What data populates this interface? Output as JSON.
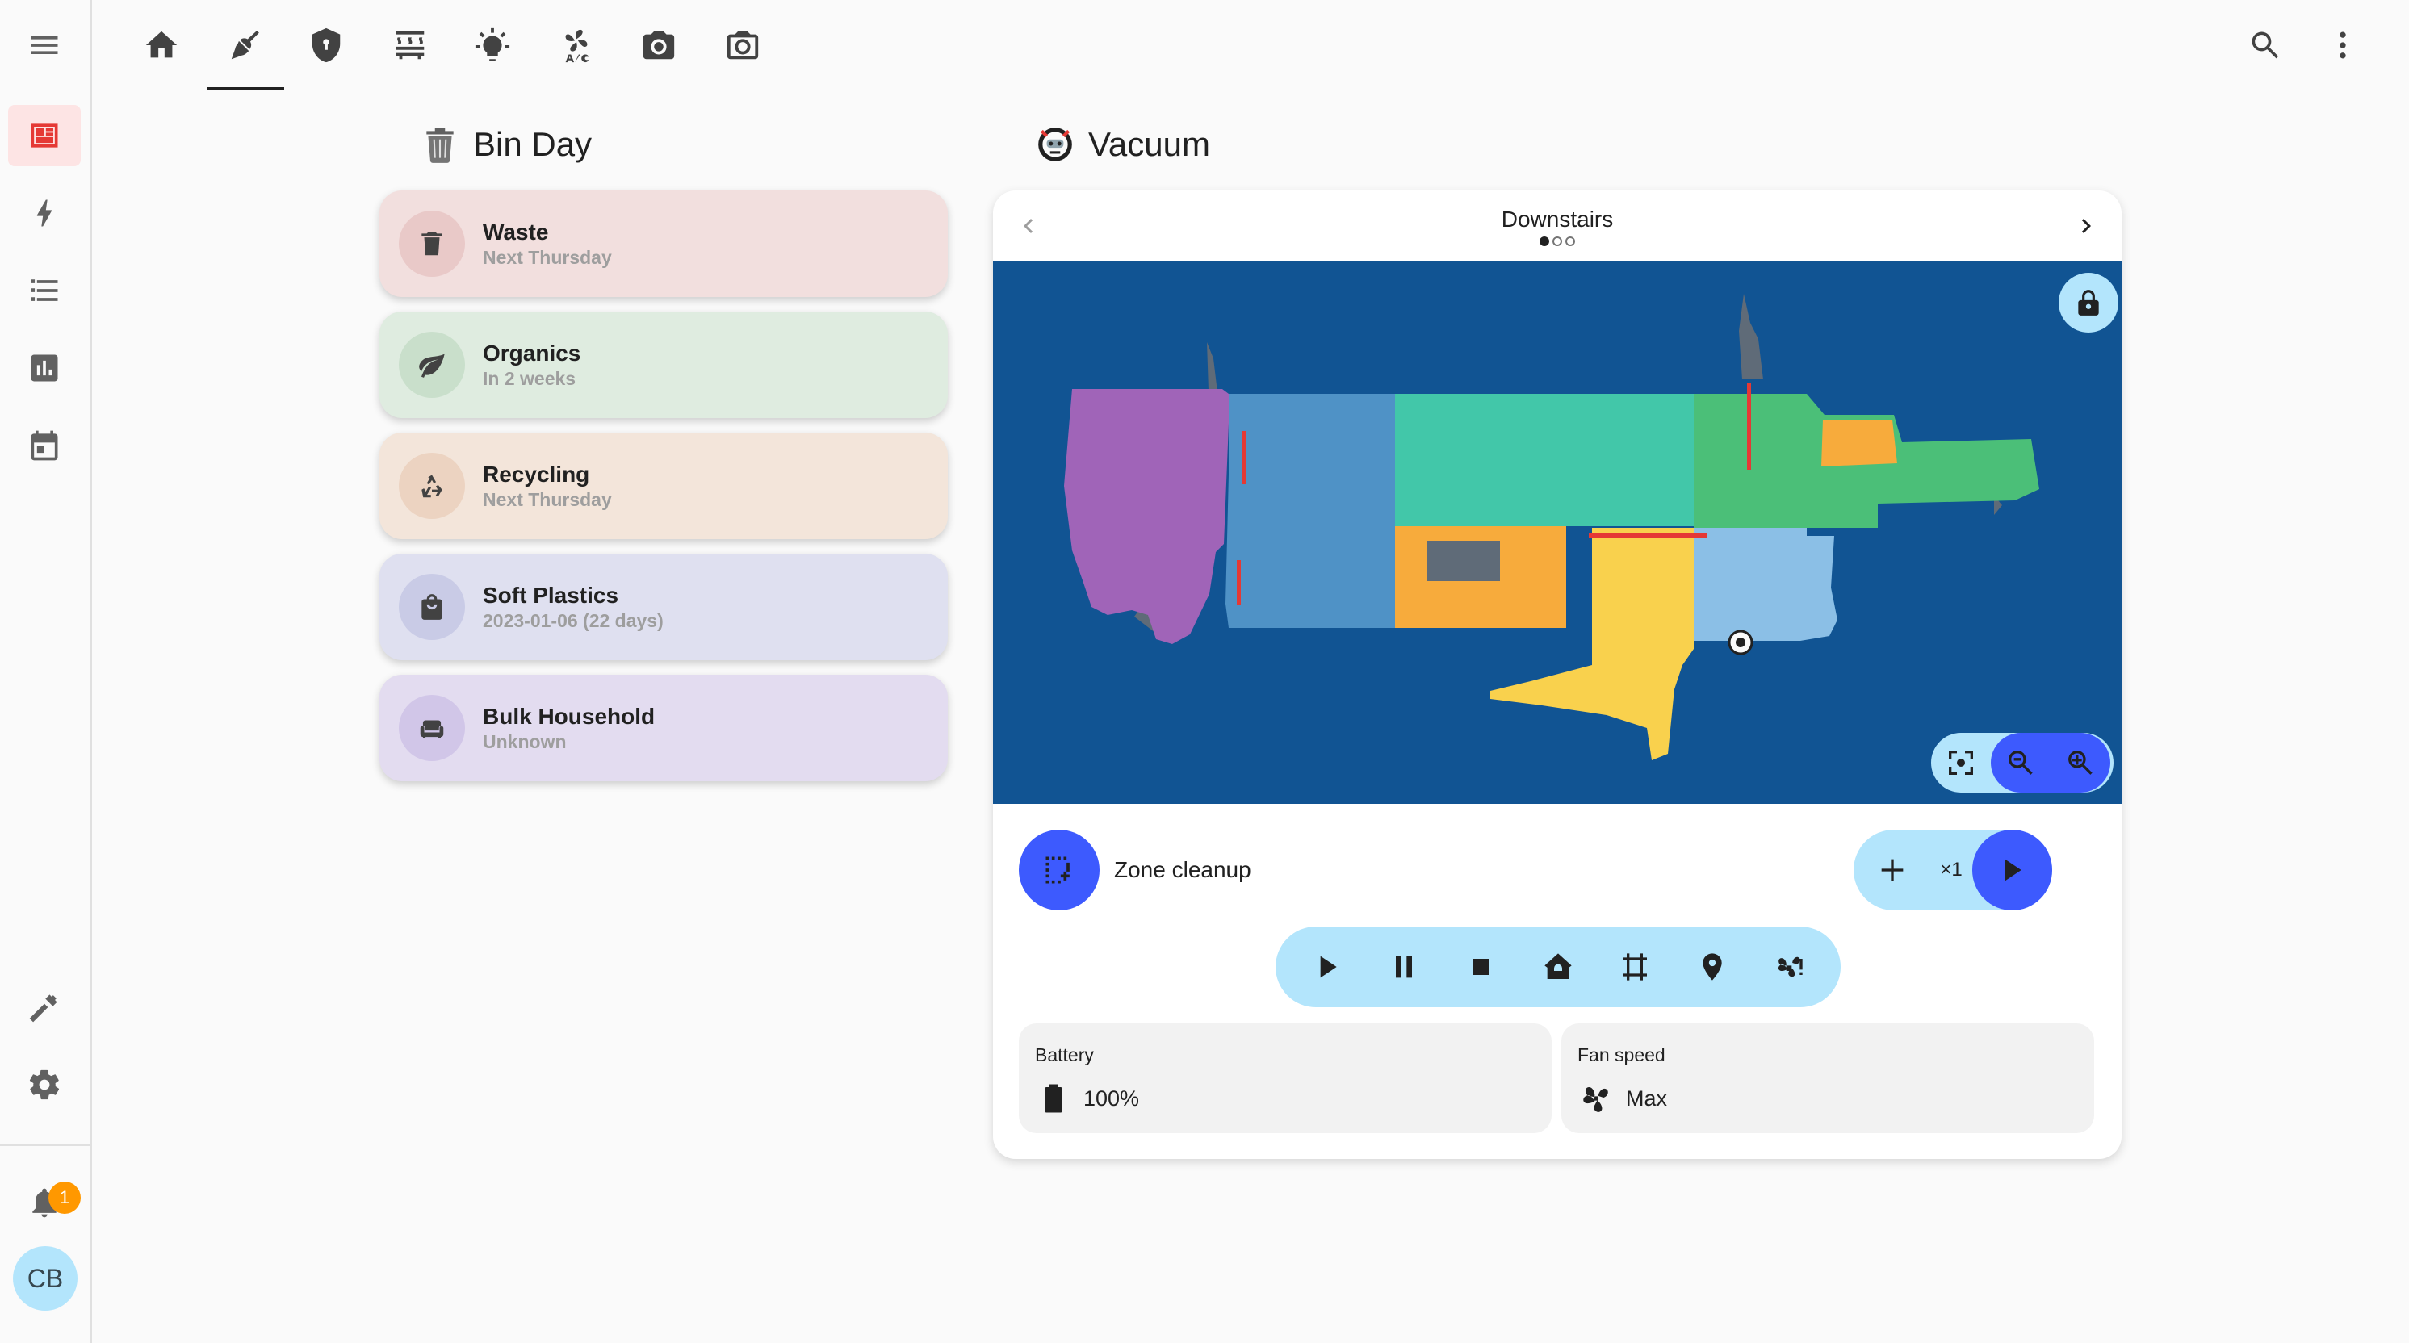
{
  "sidebar": {
    "items": [
      {
        "name": "overview",
        "icon": "dashboard-icon",
        "active": true
      },
      {
        "name": "energy",
        "icon": "lightning-icon"
      },
      {
        "name": "logbook",
        "icon": "list-icon"
      },
      {
        "name": "history",
        "icon": "chart-icon"
      },
      {
        "name": "calendar",
        "icon": "calendar-icon"
      }
    ],
    "developer_tools_icon": "hammer-icon",
    "settings_icon": "gear-icon",
    "notifications": {
      "icon": "bell-icon",
      "count": "1"
    },
    "user_initials": "CB"
  },
  "topbar": {
    "tabs": [
      {
        "icon": "home-icon"
      },
      {
        "icon": "broom-icon",
        "active": true
      },
      {
        "icon": "shield-icon"
      },
      {
        "icon": "heater-icon"
      },
      {
        "icon": "lightbulb-icon"
      },
      {
        "icon": "air-conditioner-icon"
      },
      {
        "icon": "camera-icon"
      },
      {
        "icon": "camera-outline-icon"
      }
    ],
    "search_icon": "search-icon",
    "menu_icon": "dots-vertical-icon"
  },
  "bin_day": {
    "title": "Bin Day",
    "items": [
      {
        "name": "Waste",
        "sub": "Next Thursday",
        "icon": "trash-icon",
        "bg": "#f2dfde",
        "iconbg": "#e9c9c8"
      },
      {
        "name": "Organics",
        "sub": "In 2 weeks",
        "icon": "leaf-icon",
        "bg": "#dfece0",
        "iconbg": "#c9dfcb"
      },
      {
        "name": "Recycling",
        "sub": "Next Thursday",
        "icon": "recycle-icon",
        "bg": "#f3e5da",
        "iconbg": "#ecd3c1"
      },
      {
        "name": "Soft Plastics",
        "sub": "2023-01-06 (22 days)",
        "icon": "bag-icon",
        "bg": "#dfe0f0",
        "iconbg": "#c9cbe6"
      },
      {
        "name": "Bulk Household",
        "sub": "Unknown",
        "icon": "sofa-icon",
        "bg": "#e3dcf0",
        "iconbg": "#d1c6e8"
      }
    ]
  },
  "vacuum": {
    "title": "Vacuum",
    "floor": "Downstairs",
    "floor_count": 3,
    "floor_index": 0,
    "zone_label": "Zone cleanup",
    "repeats": "×1",
    "battery_label": "Battery",
    "battery_value": "100%",
    "fan_label": "Fan speed",
    "fan_value": "Max",
    "colors": {
      "map_bg": "#115493",
      "accent": "#3d5afe",
      "button_bg": "#b3e5fc"
    }
  }
}
